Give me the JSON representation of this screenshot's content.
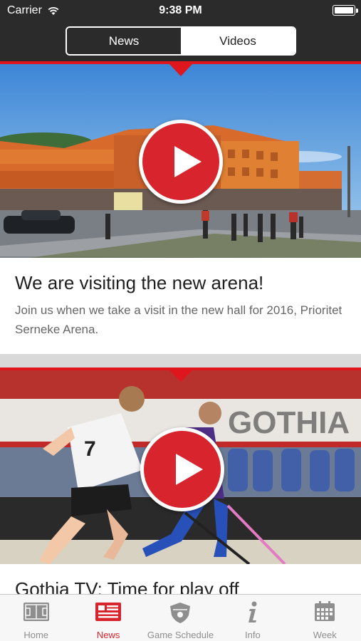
{
  "status_bar": {
    "carrier": "Carrier",
    "time": "9:38 PM"
  },
  "segment": {
    "news_label": "News",
    "videos_label": "Videos",
    "selected": "Videos"
  },
  "videos": [
    {
      "title": "We are visiting the new arena!",
      "description": "Join us when we take a visit in the new hall for 2016, Prioritet Serneke Arena."
    },
    {
      "title": "Gothia TV: Time for play off",
      "banner_text": "GOTHIA",
      "jersey_number": "7"
    }
  ],
  "tabbar": {
    "items": [
      {
        "label": "Home",
        "icon": "court-icon"
      },
      {
        "label": "News",
        "icon": "news-icon"
      },
      {
        "label": "Game Schedule",
        "icon": "shield-icon"
      },
      {
        "label": "Info",
        "icon": "info-icon"
      },
      {
        "label": "Week",
        "icon": "calendar-icon"
      }
    ],
    "active": "News"
  },
  "colors": {
    "accent": "#e0161e",
    "header": "#2b2b2b",
    "play": "#d8252d"
  }
}
